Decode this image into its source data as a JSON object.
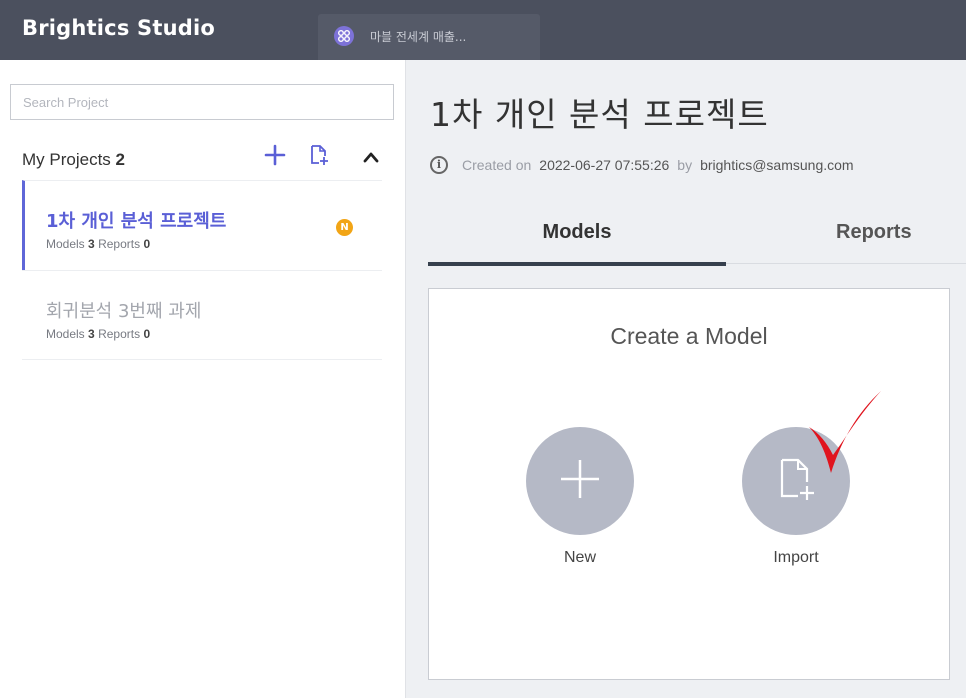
{
  "app": {
    "title": "Brightics Studio"
  },
  "open_tab": {
    "label": "마블 전세계 매출..."
  },
  "sidebar": {
    "search_placeholder": "Search Project",
    "header_label": "My Projects",
    "project_count": "2",
    "projects": [
      {
        "name": "1차 개인 분석 프로젝트",
        "models_label": "Models",
        "models": "3",
        "reports_label": "Reports",
        "reports": "0",
        "badge": "N"
      },
      {
        "name": "회귀분석 3번째 과제",
        "models_label": "Models",
        "models": "3",
        "reports_label": "Reports",
        "reports": "0"
      }
    ]
  },
  "main": {
    "title": "1차 개인 분석 프로젝트",
    "created_label": "Created on",
    "created_at": "2022-06-27 07:55:26",
    "by_label": "by",
    "author": "brightics@samsung.com",
    "tabs": [
      {
        "label": "Models"
      },
      {
        "label": "Reports"
      }
    ],
    "card": {
      "title": "Create a Model",
      "new_label": "New",
      "import_label": "Import"
    }
  },
  "colors": {
    "topbar": "#4b505e",
    "accent": "#5a5fd6",
    "badge": "#f2a516",
    "circle": "#b5b9c6",
    "checkmark": "#e0141e"
  },
  "icons": [
    "plus-icon",
    "import-file-icon",
    "chevron-up-icon",
    "info-icon",
    "model-tab-icon",
    "new-badge-icon",
    "checkmark-icon"
  ]
}
